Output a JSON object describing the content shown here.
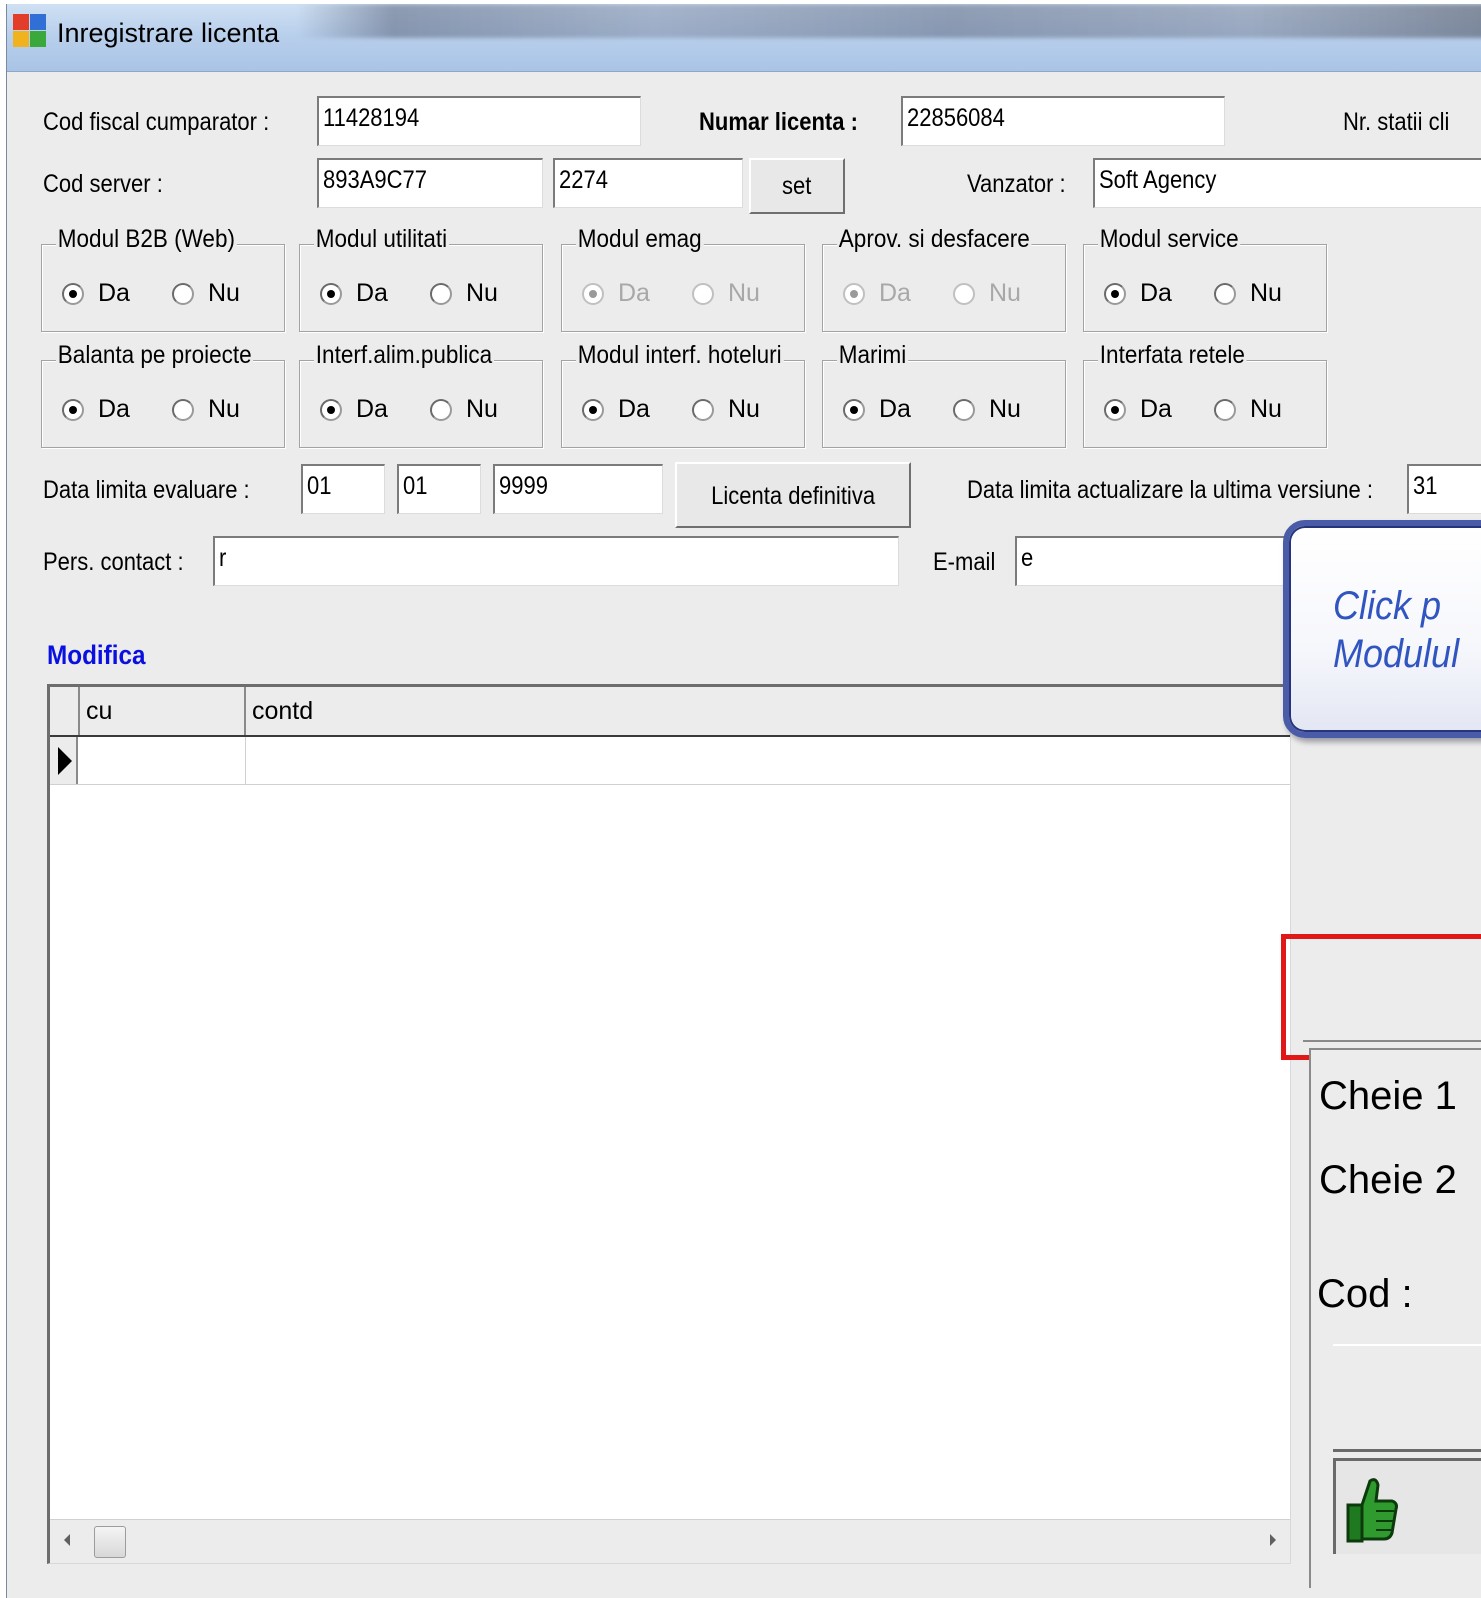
{
  "window": {
    "title": "Inregistrare licenta"
  },
  "form": {
    "cod_fiscal_label": "Cod fiscal cumparator :",
    "cod_fiscal_value": "11428194",
    "numar_licenta_label": "Numar licenta :",
    "numar_licenta_value": "22856084",
    "nr_statii_label": "Nr. statii cli",
    "cod_server_label": "Cod server :",
    "cod_server_value1": "893A9C77",
    "cod_server_value2": "2274",
    "set_button": "set",
    "vanzator_label": "Vanzator :",
    "vanzator_value": "Soft Agency",
    "data_limita_label": "Data limita evaluare :",
    "data_day": "01",
    "data_month": "01",
    "data_year": "9999",
    "licenta_definitiva_button": "Licenta definitiva",
    "data_actualizare_label": "Data limita actualizare la ultima versiune :",
    "data_actualizare_value": "31",
    "pers_contact_label": "Pers. contact :",
    "pers_contact_value": "r",
    "email_label": "E-mail",
    "email_value": "e"
  },
  "modules": [
    {
      "title": "Modul B2B (Web)",
      "da": "Da",
      "nu": "Nu",
      "selected": "Da",
      "disabled": false
    },
    {
      "title": "Modul utilitati",
      "da": "Da",
      "nu": "Nu",
      "selected": "Da",
      "disabled": false
    },
    {
      "title": "Modul emag",
      "da": "Da",
      "nu": "Nu",
      "selected": "Da",
      "disabled": true
    },
    {
      "title": "Aprov. si desfacere",
      "da": "Da",
      "nu": "Nu",
      "selected": "Da",
      "disabled": true
    },
    {
      "title": "Modul service",
      "da": "Da",
      "nu": "Nu",
      "selected": "Da",
      "disabled": false
    },
    {
      "title": "Balanta pe proiecte",
      "da": "Da",
      "nu": "Nu",
      "selected": "Da",
      "disabled": false
    },
    {
      "title": "Interf.alim.publica",
      "da": "Da",
      "nu": "Nu",
      "selected": "Da",
      "disabled": false
    },
    {
      "title": "Modul interf. hoteluri",
      "da": "Da",
      "nu": "Nu",
      "selected": "Da",
      "disabled": false
    },
    {
      "title": "Marimi",
      "da": "Da",
      "nu": "Nu",
      "selected": "Da",
      "disabled": false
    },
    {
      "title": "Interfata retele",
      "da": "Da",
      "nu": "Nu",
      "selected": "Da",
      "disabled": false
    }
  ],
  "modifica_link": "Modifica",
  "grid": {
    "columns": [
      "cu",
      "contd"
    ]
  },
  "callout": {
    "line1": "Click p",
    "line2": "Modulul"
  },
  "side": {
    "cheie1": "Cheie 1",
    "cheie2": "Cheie 2",
    "cod": "Cod :"
  },
  "colors": {
    "link": "#0a10e0",
    "highlight": "#e01818",
    "callout_text": "#3155c0"
  }
}
